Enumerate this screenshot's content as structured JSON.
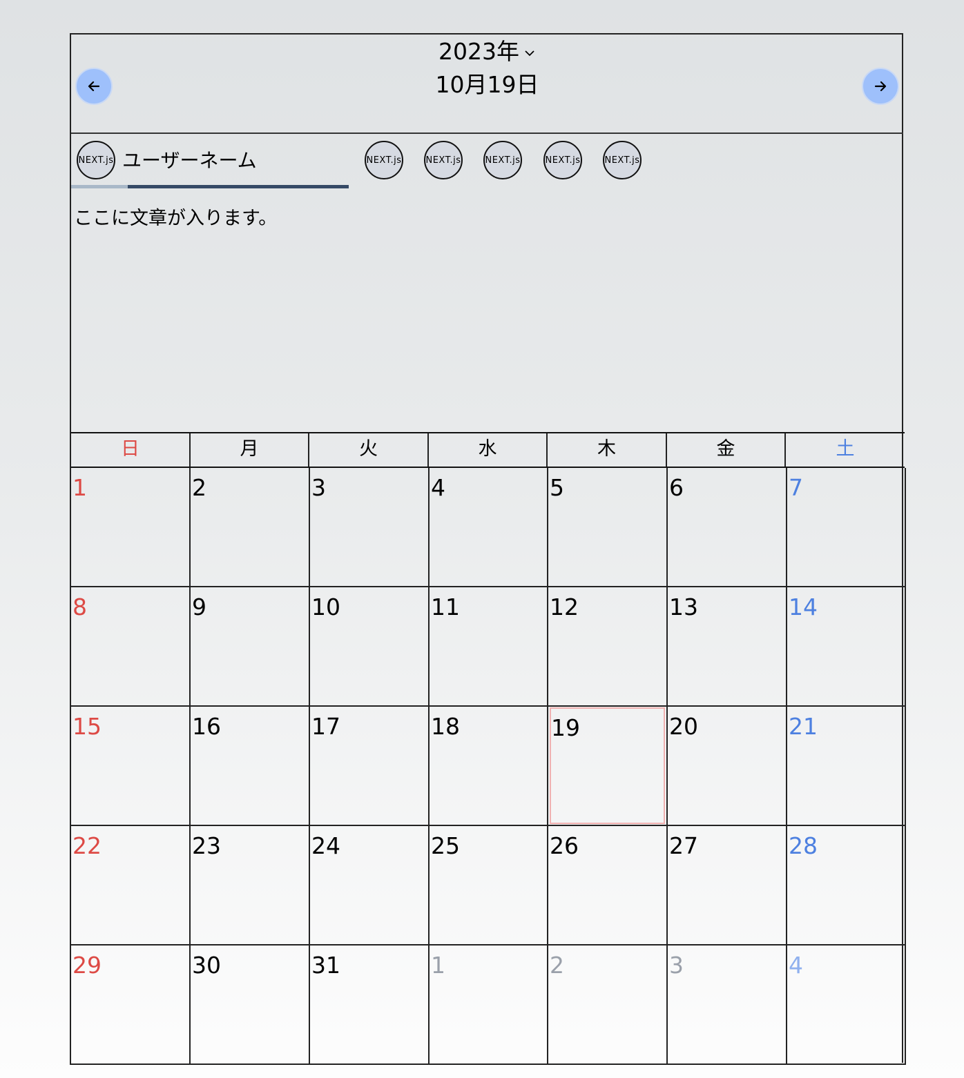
{
  "header": {
    "year": "2023年",
    "date": "10月19日",
    "prev_icon": "arrow-left-icon",
    "next_icon": "arrow-right-icon",
    "year_dropdown_icon": "chevron-down-icon"
  },
  "users": {
    "current_name": "ユーザーネーム",
    "avatar_logo": "NEXT.js",
    "other_avatars_count": 5,
    "message": "ここに文章が入ります。"
  },
  "calendar": {
    "weekdays": [
      "日",
      "月",
      "火",
      "水",
      "木",
      "金",
      "土"
    ],
    "weeks": [
      [
        "1",
        "2",
        "3",
        "4",
        "5",
        "6",
        "7"
      ],
      [
        "8",
        "9",
        "10",
        "11",
        "12",
        "13",
        "14"
      ],
      [
        "15",
        "16",
        "17",
        "18",
        "19",
        "20",
        "21"
      ],
      [
        "22",
        "23",
        "24",
        "25",
        "26",
        "27",
        "28"
      ],
      [
        "29",
        "30",
        "31",
        "1",
        "2",
        "3",
        "4"
      ]
    ],
    "today": "19",
    "colors": {
      "sunday": "#dd4a45",
      "saturday": "#4d80e0",
      "other_month": "#9aa0aa",
      "today_border": "#f0b1b1",
      "nav_button": "#9ec0fb"
    }
  }
}
